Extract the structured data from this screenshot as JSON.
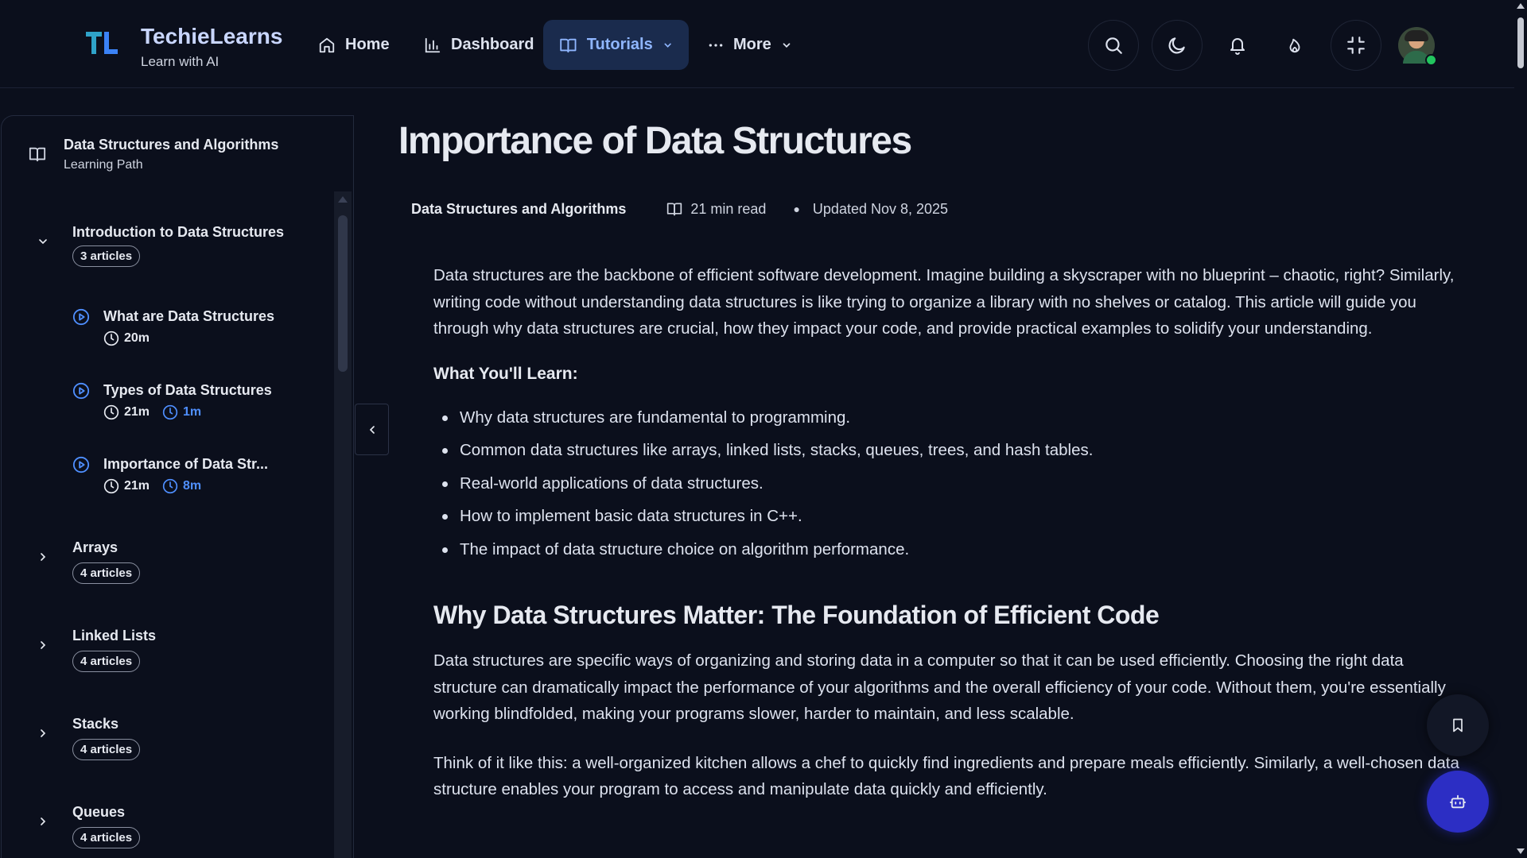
{
  "header": {
    "brand_name": "TechieLearns",
    "brand_tagline": "Learn with AI",
    "nav": {
      "home": "Home",
      "dashboard": "Dashboard",
      "tutorials": "Tutorials",
      "more": "More"
    },
    "icons": [
      "search-icon",
      "moon-icon",
      "bell-icon",
      "flame-icon",
      "minimize-icon",
      "avatar"
    ]
  },
  "sidebar": {
    "title": "Data Structures and Algorithms",
    "subtitle": "Learning Path",
    "sections": [
      {
        "title": "Introduction to Data Structures",
        "count": "3 articles",
        "expanded": true,
        "articles": [
          {
            "title": "What are Data Structures",
            "duration": "20m",
            "progress": ""
          },
          {
            "title": "Types of Data Structures",
            "duration": "21m",
            "progress": "1m"
          },
          {
            "title": "Importance of Data Str...",
            "duration": "21m",
            "progress": "8m"
          }
        ]
      },
      {
        "title": "Arrays",
        "count": "4 articles",
        "expanded": false
      },
      {
        "title": "Linked Lists",
        "count": "4 articles",
        "expanded": false
      },
      {
        "title": "Stacks",
        "count": "4 articles",
        "expanded": false
      },
      {
        "title": "Queues",
        "count": "4 articles",
        "expanded": false
      }
    ]
  },
  "article": {
    "title": "Importance of Data Structures",
    "course": "Data Structures and Algorithms",
    "read_time": "21 min read",
    "updated": "Updated Nov 8, 2025",
    "intro": "Data structures are the backbone of efficient software development. Imagine building a skyscraper with no blueprint – chaotic, right? Similarly, writing code without understanding data structures is like trying to organize a library with no shelves or catalog. This article will guide you through why data structures are crucial, how they impact your code, and provide practical examples to solidify your understanding.",
    "learn_heading": "What You'll Learn:",
    "learn_items": [
      "Why data structures are fundamental to programming.",
      "Common data structures like arrays, linked lists, stacks, queues, trees, and hash tables.",
      "Real-world applications of data structures.",
      "How to implement basic data structures in C++.",
      "The impact of data structure choice on algorithm performance."
    ],
    "section_heading": "Why Data Structures Matter: The Foundation of Efficient Code",
    "section_p1": "Data structures are specific ways of organizing and storing data in a computer so that it can be used efficiently. Choosing the right data structure can dramatically impact the performance of your algorithms and the overall efficiency of your code. Without them, you're essentially working blindfolded, making your programs slower, harder to maintain, and less scalable.",
    "section_p2": "Think of it like this: a well-organized kitchen allows a chef to quickly find ingredients and prepare meals efficiently. Similarly, a well-chosen data structure enables your program to access and manipulate data quickly and efficiently."
  },
  "colors": {
    "background": "#0b0f1c",
    "accent": "#4f8fff",
    "active_nav_bg": "#1a2b4d",
    "fab_bot": "#2c2ec4",
    "online": "#22c55e"
  }
}
